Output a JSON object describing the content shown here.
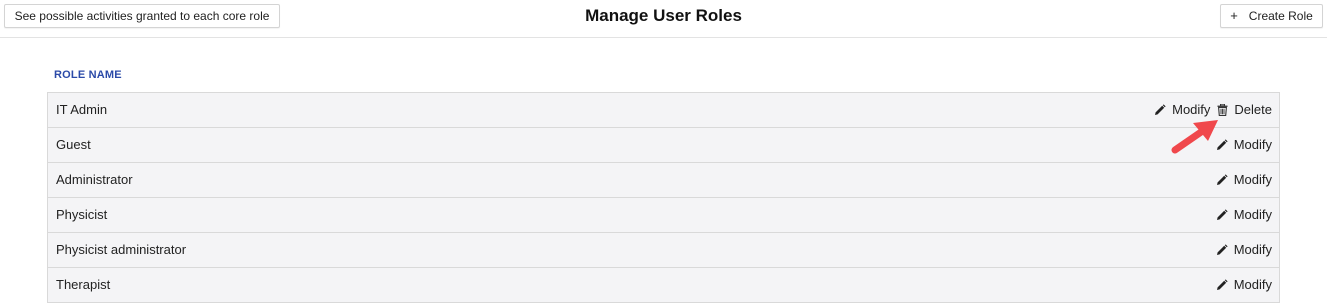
{
  "header": {
    "activities_button_label": "See possible activities granted to each core role",
    "title": "Manage User Roles",
    "create_button_plus": "+",
    "create_button_label": "Create Role"
  },
  "table": {
    "column_header": "ROLE NAME",
    "rows": [
      {
        "name": "IT Admin",
        "modify_label": "Modify",
        "delete_label": "Delete"
      },
      {
        "name": "Guest",
        "modify_label": "Modify"
      },
      {
        "name": "Administrator",
        "modify_label": "Modify"
      },
      {
        "name": "Physicist",
        "modify_label": "Modify"
      },
      {
        "name": "Physicist administrator",
        "modify_label": "Modify"
      },
      {
        "name": "Therapist",
        "modify_label": "Modify"
      }
    ]
  },
  "icons": {
    "modify": "pencil-icon",
    "delete": "trash-icon",
    "annotation": "red-arrow-icon"
  },
  "colors": {
    "column_header": "#2b4aa8",
    "row_background": "#f4f4f6",
    "annotation_arrow": "#f0484c"
  }
}
